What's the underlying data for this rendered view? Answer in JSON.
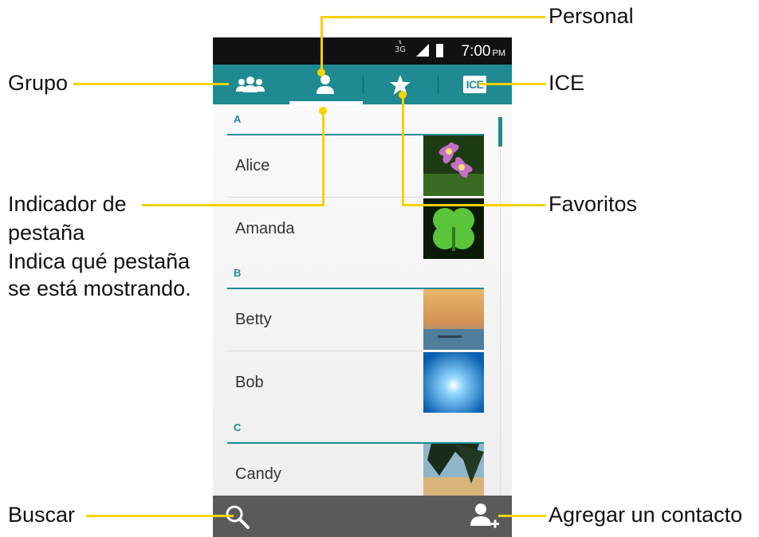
{
  "callouts": {
    "personal": "Personal",
    "grupo": "Grupo",
    "ice": "ICE",
    "indicador_1": "Indicador de",
    "indicador_2": "pestaña",
    "indicador_3": "Indica qué pestaña",
    "indicador_4": "se está mostrando.",
    "favoritos": "Favoritos",
    "buscar": "Buscar",
    "agregar": "Agregar un contacto"
  },
  "statusbar": {
    "network": "3G",
    "time": "7:00",
    "ampm": "PM"
  },
  "tabs": {
    "grupo": "group-icon",
    "personal": "person-icon",
    "favoritos": "star-icon",
    "ice_label": "ICE"
  },
  "contacts": {
    "sections": [
      {
        "letter": "A",
        "names": [
          "Alice",
          "Amanda"
        ]
      },
      {
        "letter": "B",
        "names": [
          "Betty",
          "Bob"
        ]
      },
      {
        "letter": "C",
        "names": [
          "Candy"
        ]
      }
    ]
  },
  "colors": {
    "accent": "#1f8a92",
    "callout": "#f5d200",
    "statusbar": "#111111",
    "bottombar": "#5a5a5a"
  }
}
